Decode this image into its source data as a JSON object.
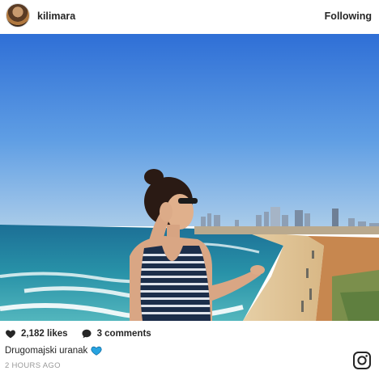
{
  "post": {
    "username": "kilimara",
    "follow_state": "Following",
    "likes": "2,182 likes",
    "comments": "3 comments",
    "caption": "Drugomajski uranak",
    "caption_emoji": "blue-heart-icon",
    "timestamp": "2 HOURS AGO"
  },
  "colors": {
    "sky_top": "#2f6fd6",
    "sea": "#1f8aa8",
    "accent_heart": "#27a3e0"
  },
  "icons": [
    "avatar",
    "heart-icon",
    "comment-bubble-icon",
    "blue-heart-icon",
    "instagram-logo-icon"
  ]
}
